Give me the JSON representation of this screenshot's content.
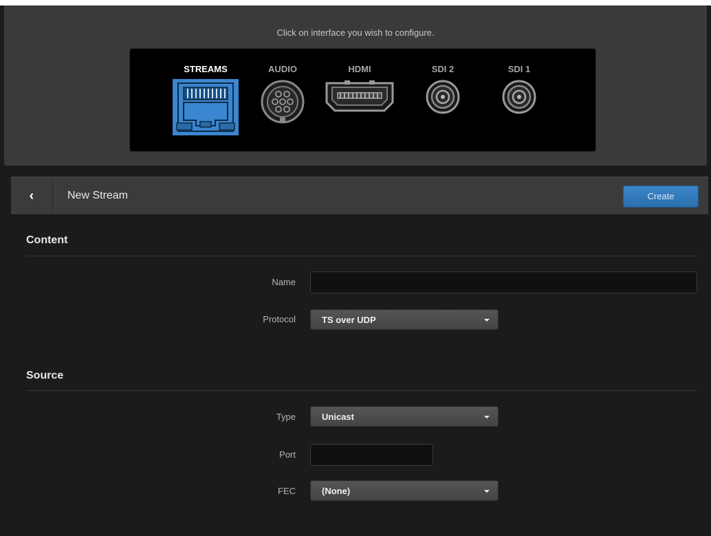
{
  "interfaces": {
    "hint": "Click on interface you wish to configure.",
    "items": [
      {
        "label": "STREAMS",
        "icon": "ethernet-port-icon",
        "active": true
      },
      {
        "label": "AUDIO",
        "icon": "audio-connector-icon",
        "active": false
      },
      {
        "label": "HDMI",
        "icon": "hdmi-port-icon",
        "active": false
      },
      {
        "label": "SDI 2",
        "icon": "bnc-connector-icon",
        "active": false
      },
      {
        "label": "SDI 1",
        "icon": "bnc-connector-icon",
        "active": false
      }
    ],
    "active_color": "#3a86d0"
  },
  "toolbar": {
    "back_glyph": "‹",
    "title": "New Stream",
    "create_label": "Create"
  },
  "content": {
    "title": "Content",
    "name_label": "Name",
    "name_value": "",
    "protocol_label": "Protocol",
    "protocol_value": "TS over UDP"
  },
  "source": {
    "title": "Source",
    "type_label": "Type",
    "type_value": "Unicast",
    "port_label": "Port",
    "port_value": "",
    "fec_label": "FEC",
    "fec_value": "(None)"
  }
}
